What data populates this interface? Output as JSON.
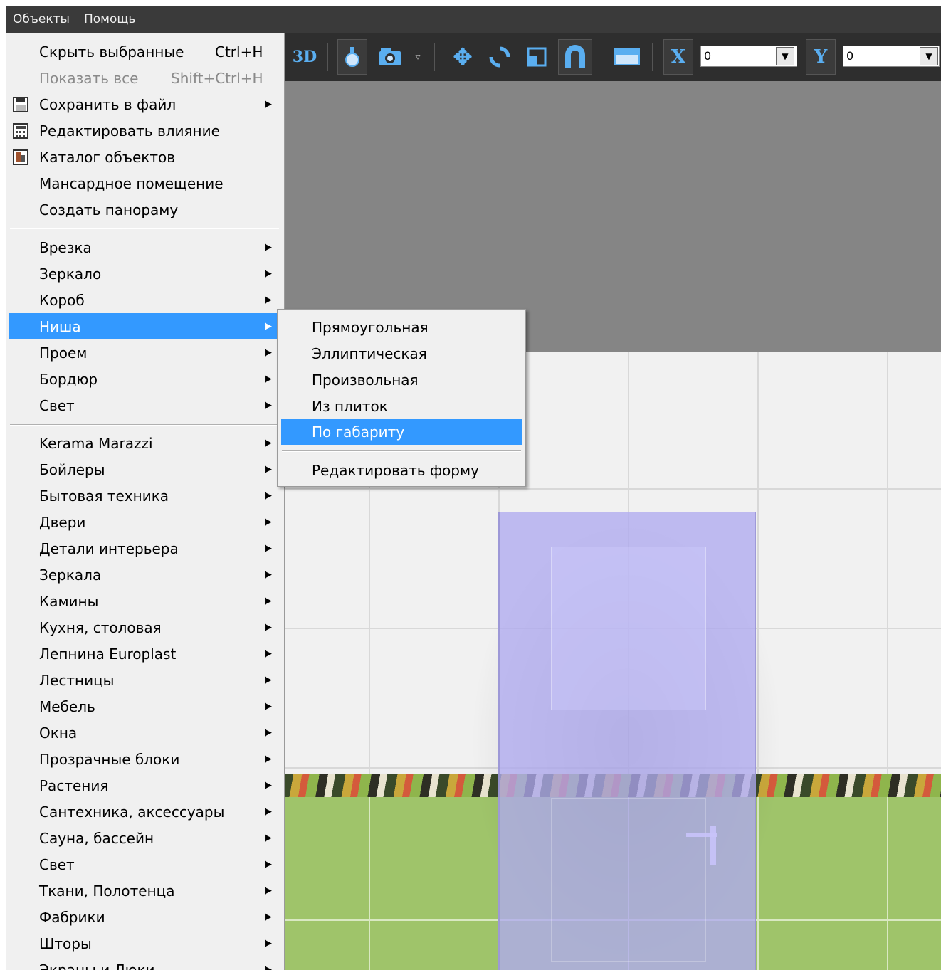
{
  "menubar": {
    "items": [
      "Объекты",
      "Помощь"
    ]
  },
  "toolbar": {
    "view3d_label": "3D",
    "x_label": "X",
    "x_value": "0",
    "y_label": "Y",
    "y_value": "0",
    "icons": [
      "light-bulb-icon",
      "camera-icon",
      "move-icon",
      "rotate-icon",
      "resize-icon",
      "magnet-icon",
      "ruler-icon"
    ]
  },
  "menu": {
    "items": [
      {
        "label": "Скрыть выбранные",
        "shortcut": "Ctrl+H"
      },
      {
        "label": "Показать все",
        "shortcut": "Shift+Ctrl+H",
        "disabled": true
      },
      {
        "label": "Сохранить в файл",
        "submenu": true,
        "icon": "save-icon"
      },
      {
        "label": "Редактировать влияние",
        "icon": "calculator-icon"
      },
      {
        "label": "Каталог объектов",
        "icon": "catalog-icon"
      },
      {
        "label": "Мансардное помещение"
      },
      {
        "label": "Создать панораму"
      },
      {
        "label": "Врезка",
        "submenu": true
      },
      {
        "label": "Зеркало",
        "submenu": true
      },
      {
        "label": "Короб",
        "submenu": true
      },
      {
        "label": "Ниша",
        "submenu": true,
        "highlighted": true
      },
      {
        "label": "Проем",
        "submenu": true
      },
      {
        "label": "Бордюр",
        "submenu": true
      },
      {
        "label": "Свет",
        "submenu": true
      },
      {
        "label": "Kerama Marazzi",
        "submenu": true
      },
      {
        "label": "Бойлеры",
        "submenu": true
      },
      {
        "label": "Бытовая техника",
        "submenu": true
      },
      {
        "label": "Двери",
        "submenu": true
      },
      {
        "label": "Детали интерьера",
        "submenu": true
      },
      {
        "label": "Зеркала",
        "submenu": true
      },
      {
        "label": "Камины",
        "submenu": true
      },
      {
        "label": "Кухня, столовая",
        "submenu": true
      },
      {
        "label": "Лепнина Europlast",
        "submenu": true
      },
      {
        "label": "Лестницы",
        "submenu": true
      },
      {
        "label": "Мебель",
        "submenu": true
      },
      {
        "label": "Окна",
        "submenu": true
      },
      {
        "label": "Прозрачные блоки",
        "submenu": true
      },
      {
        "label": "Растения",
        "submenu": true
      },
      {
        "label": "Сантехника, аксессуары",
        "submenu": true
      },
      {
        "label": "Сауна, бассейн",
        "submenu": true
      },
      {
        "label": "Свет",
        "submenu": true
      },
      {
        "label": "Ткани, Полотенца",
        "submenu": true
      },
      {
        "label": "Фабрики",
        "submenu": true
      },
      {
        "label": "Шторы",
        "submenu": true
      },
      {
        "label": "Экраны и Люки",
        "submenu": true
      }
    ]
  },
  "submenu": {
    "items": [
      {
        "label": "Прямоугольная"
      },
      {
        "label": "Эллиптическая"
      },
      {
        "label": "Произвольная"
      },
      {
        "label": "Из плиток"
      },
      {
        "label": "По габариту",
        "highlighted": true
      },
      {
        "label": "Редактировать форму"
      }
    ]
  },
  "colors": {
    "highlight": "#3399ff",
    "menu_bg": "#f0f0f0",
    "toolbar_bg": "#2e2e2e",
    "accent_icon": "#5aaef0"
  }
}
